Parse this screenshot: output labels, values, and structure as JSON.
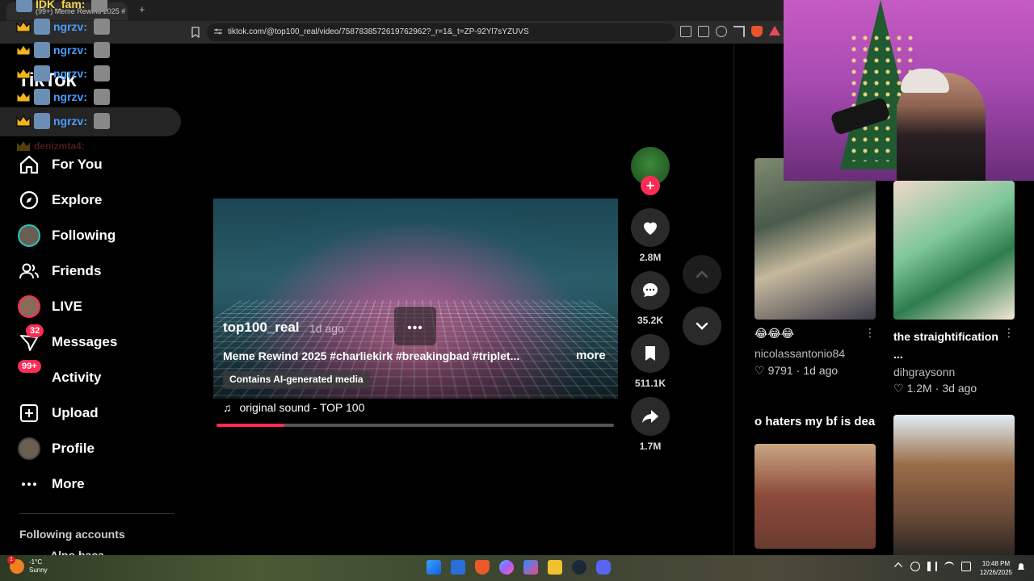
{
  "browser": {
    "tab_title": "(99+) Meme Rewind 2025 #",
    "url": "tiktok.com/@top100_real/video/7587838572619762962?_r=1&_t=ZP-92Yl7sYZUVS"
  },
  "chat_overlay": {
    "rows": [
      {
        "name": "IDK_fam:"
      },
      {
        "name": "ngrzv:"
      },
      {
        "name": "ngrzv:"
      },
      {
        "name": "ngrzv:"
      },
      {
        "name": "ngrzv:"
      },
      {
        "name": "ngrzv:"
      },
      {
        "name": "denizmta4:"
      }
    ]
  },
  "tiktok": {
    "logo": "TikTok",
    "nav": [
      {
        "label": "For You"
      },
      {
        "label": "Explore"
      },
      {
        "label": "Following"
      },
      {
        "label": "Friends"
      },
      {
        "label": "LIVE"
      },
      {
        "label": "Messages",
        "badge": "32"
      },
      {
        "label": "Activity",
        "badge": "99+"
      },
      {
        "label": "Upload"
      },
      {
        "label": "Profile"
      },
      {
        "label": "More"
      }
    ],
    "following_header": "Following accounts",
    "following_first": "Alpo baca",
    "video": {
      "username": "top100_real",
      "time": "1d ago",
      "description": "Meme Rewind 2025 #charliekirk #breakingbad #triplet...",
      "more": "more",
      "ai_label": "Contains AI-generated media",
      "sound": "original sound - TOP 100",
      "progress_pct": 17
    },
    "actions": {
      "likes": "2.8M",
      "comments": "35.2K",
      "saves": "511.1K",
      "shares": "1.7M"
    },
    "cards": [
      {
        "title": "😂😂😂",
        "user": "nicolassantonio84",
        "likes": "9791",
        "time": "1d ago"
      },
      {
        "title": "the straightification ...",
        "user": "dihgraysonn",
        "likes": "1.2M",
        "time": "3d ago"
      },
      {
        "title": "o haters my bf is dead"
      }
    ]
  },
  "taskbar": {
    "temp": "-1°C",
    "condition": "Sunny",
    "weather_badge": "1",
    "time": "10:48 PM",
    "date": "12/26/2025"
  }
}
